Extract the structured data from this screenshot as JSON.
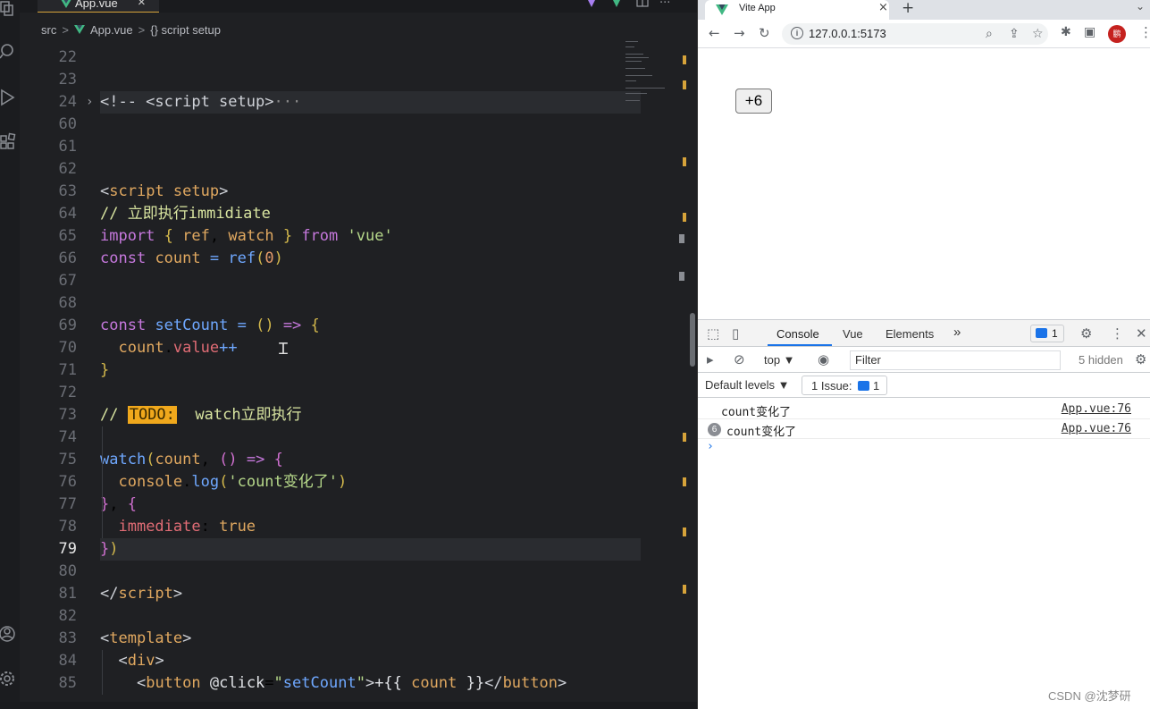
{
  "editor": {
    "tab": {
      "label": "App.vue",
      "close": "×"
    },
    "breadcrumb": {
      "folder": "src",
      "file": "App.vue",
      "symbol": "{} script setup",
      "sep": ">"
    },
    "header_icons": {
      "more": "···"
    },
    "lines": [
      {
        "n": "22",
        "html": ""
      },
      {
        "n": "23",
        "html": ""
      },
      {
        "n": "24",
        "html": "<span class='c-tag'>&lt;!-- &lt;script setup&gt;</span><span style='color:#888'>···</span>",
        "fold": "›",
        "highlight": true
      },
      {
        "n": "60",
        "html": ""
      },
      {
        "n": "61",
        "html": ""
      },
      {
        "n": "62",
        "html": ""
      },
      {
        "n": "63",
        "html": "<span class='c-tag'>&lt;</span><span class='c-var'>script</span> <span class='c-var'>setup</span><span class='c-tag'>&gt;</span>"
      },
      {
        "n": "64",
        "html": "<span class='c-com'>// 立即执行immidiate</span>"
      },
      {
        "n": "65",
        "html": "<span class='c-kw'>import</span> <span class='c-brk'>{</span> <span class='c-var'>ref</span>, <span class='c-var'>watch</span> <span class='c-brk'>}</span> <span class='c-kw'>from</span> <span class='c-str'>'vue'</span>"
      },
      {
        "n": "66",
        "html": "<span class='c-kw'>const</span> <span class='c-var'>count</span> <span class='c-fn'>=</span> <span class='c-fn'>ref</span><span class='c-brk'>(</span><span class='c-num'>0</span><span class='c-brk'>)</span>"
      },
      {
        "n": "67",
        "html": ""
      },
      {
        "n": "68",
        "html": ""
      },
      {
        "n": "69",
        "html": "<span class='c-kw'>const</span> <span class='c-fn'>setCount</span> <span class='c-fn'>=</span> <span class='c-brk'>()</span> <span class='c-kw'>=&gt;</span> <span class='c-brk'>{</span>"
      },
      {
        "n": "70",
        "html": "  <span class='c-var'>count</span>.<span class='c-prop'>value</span><span class='c-fn'>++</span>"
      },
      {
        "n": "71",
        "html": "<span class='c-brk'>}</span>"
      },
      {
        "n": "72",
        "html": ""
      },
      {
        "n": "73",
        "html": "<span class='c-com'>// </span><span class='todo'>TODO:</span><span class='c-com'>  watch立即执行</span>"
      },
      {
        "n": "74",
        "html": ""
      },
      {
        "n": "75",
        "html": "<span class='c-fn'>watch</span><span class='c-brk'>(</span><span class='c-var'>count</span>, <span class='c-brk2'>()</span> <span class='c-kw'>=&gt;</span> <span class='c-brk2'>{</span>"
      },
      {
        "n": "76",
        "html": "  <span class='c-var'>console</span>.<span class='c-fn'>log</span><span class='c-brk'>(</span><span class='c-str'>'count变化了'</span><span class='c-brk'>)</span>"
      },
      {
        "n": "77",
        "html": "<span class='c-brk2'>}</span>, <span class='c-brk2'>{</span>"
      },
      {
        "n": "78",
        "html": "  <span class='c-prop'>immediate</span>: <span class='c-var'>true</span>"
      },
      {
        "n": "79",
        "html": "<span class='c-brk2'>}</span><span class='c-brk'>)</span>",
        "current": true,
        "highlight": true
      },
      {
        "n": "80",
        "html": ""
      },
      {
        "n": "81",
        "html": "<span class='c-tag'>&lt;/</span><span class='c-var'>script</span><span class='c-tag'>&gt;</span>"
      },
      {
        "n": "82",
        "html": ""
      },
      {
        "n": "83",
        "html": "<span class='c-tag'>&lt;</span><span class='c-var'>template</span><span class='c-tag'>&gt;</span>"
      },
      {
        "n": "84",
        "html": "  <span class='c-tag'>&lt;</span><span class='c-var'>div</span><span class='c-tag'>&gt;</span>"
      },
      {
        "n": "85",
        "html": "    <span class='c-tag'>&lt;</span><span class='c-var'>button</span> <span class='c-white'>@click</span>=<span class='c-str'>\"</span><span class='c-fn'>setCount</span><span class='c-str'>\"</span><span class='c-tag'>&gt;</span><span class='c-white'>+{{</span> <span class='c-var'>count</span> <span class='c-white'>}}</span><span class='c-tag'>&lt;/</span><span class='c-var'>button</span><span class='c-tag'>&gt;</span>"
      }
    ],
    "colors": {
      "accent": "#d6a33a",
      "background": "#1f2023",
      "todo": "#f0a81c"
    }
  },
  "browser": {
    "tab": {
      "title": "Vite App",
      "close": "×",
      "new": "+"
    },
    "url": "127.0.0.1:5173",
    "profile_initial": "鹏",
    "page": {
      "button_label": "+6"
    },
    "devtools": {
      "tabs": [
        "Console",
        "Vue",
        "Elements"
      ],
      "more": "»",
      "issues_badge": "1",
      "context": "top ▼",
      "filter_placeholder": "Filter",
      "hidden": "5 hidden",
      "levels": "Default levels ▼",
      "issue_chip": {
        "label": "1 Issue:",
        "count": "1"
      },
      "logs": [
        {
          "message": "count变化了",
          "source": "App.vue:76",
          "repeat": ""
        },
        {
          "message": "count变化了",
          "source": "App.vue:76",
          "repeat": "6"
        }
      ],
      "prompt": "›"
    }
  },
  "watermark": "CSDN @沈梦研"
}
